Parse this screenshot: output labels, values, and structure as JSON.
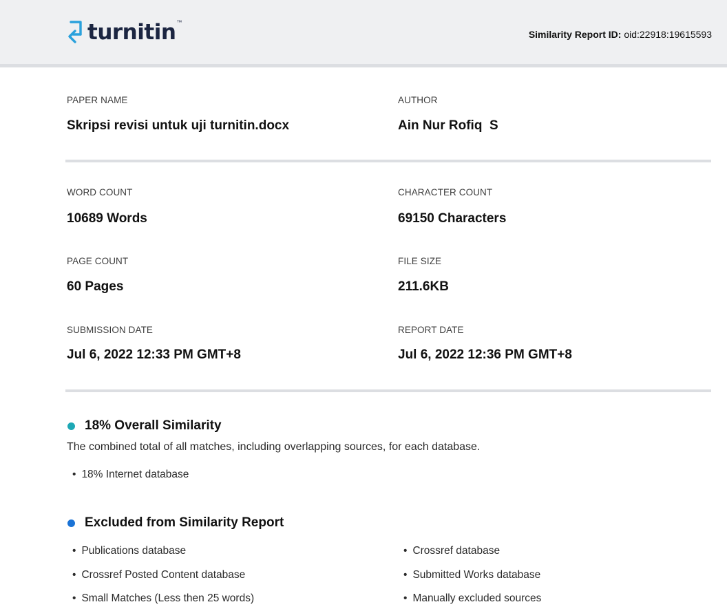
{
  "header": {
    "logo_text": "turnitin",
    "logo_tm": "™",
    "report_id_label": "Similarity Report ID:",
    "report_id_value": "oid:22918:19615593"
  },
  "fields": {
    "paper_name": {
      "label": "PAPER NAME",
      "value": "Skripsi revisi untuk uji turnitin.docx"
    },
    "author": {
      "label": "AUTHOR",
      "value": "Ain Nur Rofiq  S"
    },
    "word_count": {
      "label": "WORD COUNT",
      "value": "10689 Words"
    },
    "character_count": {
      "label": "CHARACTER COUNT",
      "value": "69150 Characters"
    },
    "page_count": {
      "label": "PAGE COUNT",
      "value": "60 Pages"
    },
    "file_size": {
      "label": "FILE SIZE",
      "value": "211.6KB"
    },
    "submission_date": {
      "label": "SUBMISSION DATE",
      "value": "Jul 6, 2022 12:33 PM GMT+8"
    },
    "report_date": {
      "label": "REPORT DATE",
      "value": "Jul 6, 2022 12:36 PM GMT+8"
    }
  },
  "similarity": {
    "title": "18% Overall Similarity",
    "dot_color": "#1ea8b5",
    "description": "The combined total of all matches, including overlapping sources, for each database.",
    "items": [
      "18% Internet database"
    ]
  },
  "excluded": {
    "title": "Excluded from Similarity Report",
    "dot_color": "#1a73d6",
    "items": [
      "Publications database",
      "Crossref database",
      "Crossref Posted Content database",
      "Submitted Works database",
      "Small Matches (Less then 25 words)",
      "Manually excluded sources"
    ]
  },
  "bullet_char": "•"
}
